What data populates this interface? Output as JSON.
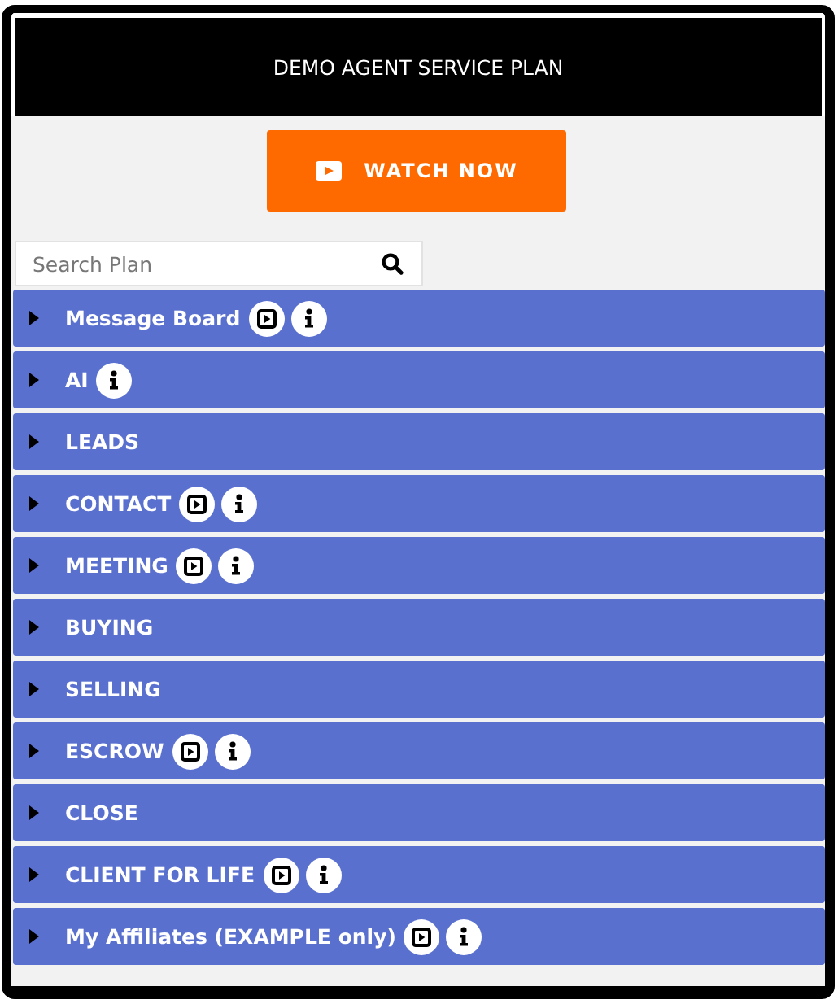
{
  "header": {
    "title": "DEMO AGENT SERVICE PLAN"
  },
  "watch_button": {
    "label": "WATCH NOW"
  },
  "search": {
    "placeholder": "Search Plan"
  },
  "sections": [
    {
      "label": "Message Board",
      "expanded": false,
      "has_video": true,
      "has_info": true
    },
    {
      "label": "AI",
      "expanded": false,
      "has_video": false,
      "has_info": true
    },
    {
      "label": "LEADS",
      "expanded": false,
      "has_video": false,
      "has_info": false
    },
    {
      "label": "CONTACT",
      "expanded": false,
      "has_video": true,
      "has_info": true
    },
    {
      "label": "MEETING",
      "expanded": false,
      "has_video": true,
      "has_info": true
    },
    {
      "label": "BUYING",
      "expanded": false,
      "has_video": false,
      "has_info": false
    },
    {
      "label": "SELLING",
      "expanded": false,
      "has_video": false,
      "has_info": false
    },
    {
      "label": "ESCROW",
      "expanded": false,
      "has_video": true,
      "has_info": true
    },
    {
      "label": "CLOSE",
      "expanded": false,
      "has_video": false,
      "has_info": false
    },
    {
      "label": "CLIENT FOR LIFE",
      "expanded": false,
      "has_video": true,
      "has_info": true
    },
    {
      "label": "My Affiliates (EXAMPLE only)",
      "expanded": false,
      "has_video": true,
      "has_info": true
    }
  ]
}
